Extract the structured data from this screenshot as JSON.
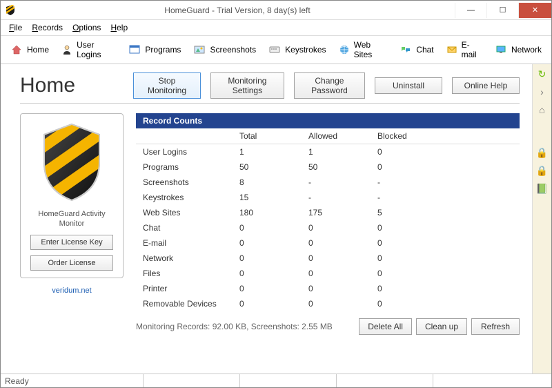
{
  "window": {
    "title": "HomeGuard - Trial Version, 8 day(s) left"
  },
  "menu": {
    "file": "File",
    "records": "Records",
    "options": "Options",
    "help": "Help"
  },
  "toolbar": {
    "home": "Home",
    "userlogins": "User Logins",
    "programs": "Programs",
    "screenshots": "Screenshots",
    "keystrokes": "Keystrokes",
    "websites": "Web Sites",
    "chat": "Chat",
    "email": "E-mail",
    "network": "Network"
  },
  "page": {
    "title": "Home"
  },
  "actions": {
    "stop": "Stop Monitoring",
    "settings": "Monitoring Settings",
    "changepw": "Change Password",
    "uninstall": "Uninstall",
    "help": "Online Help"
  },
  "leftbox": {
    "caption": "HomeGuard Activity Monitor",
    "enterkey": "Enter License Key",
    "order": "Order License",
    "vendor": "veridum.net"
  },
  "table": {
    "header": "Record Counts",
    "cols": {
      "c0": "",
      "c1": "Total",
      "c2": "Allowed",
      "c3": "Blocked"
    },
    "rows": [
      {
        "name": "User Logins",
        "total": "1",
        "allowed": "1",
        "blocked": "0"
      },
      {
        "name": "Programs",
        "total": "50",
        "allowed": "50",
        "blocked": "0"
      },
      {
        "name": "Screenshots",
        "total": "8",
        "allowed": "-",
        "blocked": "-"
      },
      {
        "name": "Keystrokes",
        "total": "15",
        "allowed": "-",
        "blocked": "-"
      },
      {
        "name": "Web Sites",
        "total": "180",
        "allowed": "175",
        "blocked": "5"
      },
      {
        "name": "Chat",
        "total": "0",
        "allowed": "0",
        "blocked": "0"
      },
      {
        "name": "E-mail",
        "total": "0",
        "allowed": "0",
        "blocked": "0"
      },
      {
        "name": "Network",
        "total": "0",
        "allowed": "0",
        "blocked": "0"
      },
      {
        "name": "Files",
        "total": "0",
        "allowed": "0",
        "blocked": "0"
      },
      {
        "name": "Printer",
        "total": "0",
        "allowed": "0",
        "blocked": "0"
      },
      {
        "name": "Removable Devices",
        "total": "0",
        "allowed": "0",
        "blocked": "0"
      }
    ]
  },
  "footer": {
    "summary": "Monitoring Records: 92.00 KB, Screenshots: 2.55 MB",
    "deleteall": "Delete All",
    "cleanup": "Clean up",
    "refresh": "Refresh"
  },
  "status": {
    "ready": "Ready"
  }
}
